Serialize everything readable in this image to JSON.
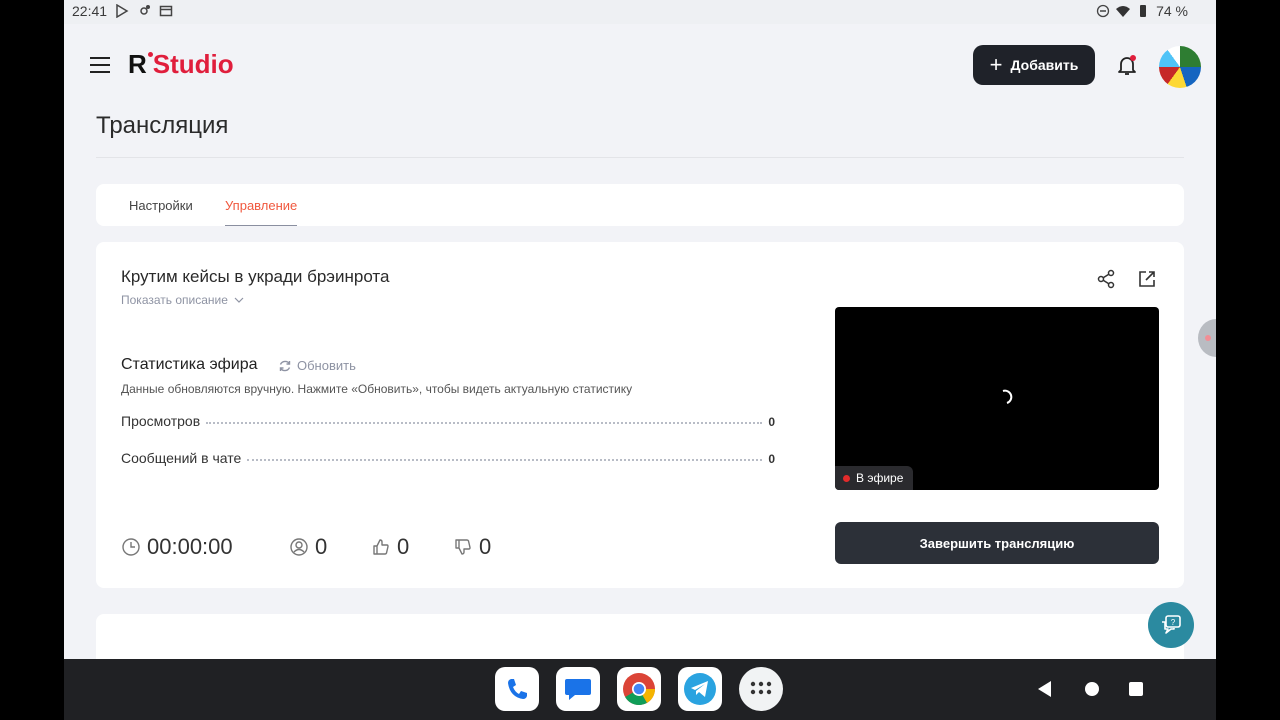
{
  "statusbar": {
    "time": "22:41",
    "battery": "74 %"
  },
  "header": {
    "add_label": "Добавить"
  },
  "page": {
    "title": "Трансляция"
  },
  "tabs": [
    {
      "label": "Настройки"
    },
    {
      "label": "Управление"
    }
  ],
  "stream": {
    "title": "Крутим кейсы в укради брэинрота",
    "show_description": "Показать описание",
    "stats_title": "Статистика эфира",
    "refresh_label": "Обновить",
    "stats_note": "Данные обновляются вручную. Нажмите «Обновить», чтобы видеть актуальную статистику",
    "rows": [
      {
        "label": "Просмотров",
        "value": "0"
      },
      {
        "label": "Сообщений в чате",
        "value": "0"
      }
    ],
    "duration": "00:00:00",
    "viewers": "0",
    "likes": "0",
    "dislikes": "0",
    "live_label": "В эфире",
    "end_label": "Завершить трансляцию"
  },
  "colors": {
    "accent": "#f0583e",
    "brand": "#e01e3c",
    "dark_button": "#1f2229",
    "help": "#2b8aa0"
  },
  "icons": [
    "play-store-icon",
    "settings-icon",
    "calendar-icon",
    "dnd-icon",
    "wifi-icon",
    "battery-icon",
    "menu-icon",
    "bell-icon",
    "share-icon",
    "external-link-icon",
    "refresh-icon",
    "clock-icon",
    "user-icon",
    "thumbs-up-icon",
    "thumbs-down-icon",
    "help-chat-icon",
    "phone-icon",
    "messages-icon",
    "chrome-icon",
    "telegram-icon",
    "apps-icon"
  ]
}
